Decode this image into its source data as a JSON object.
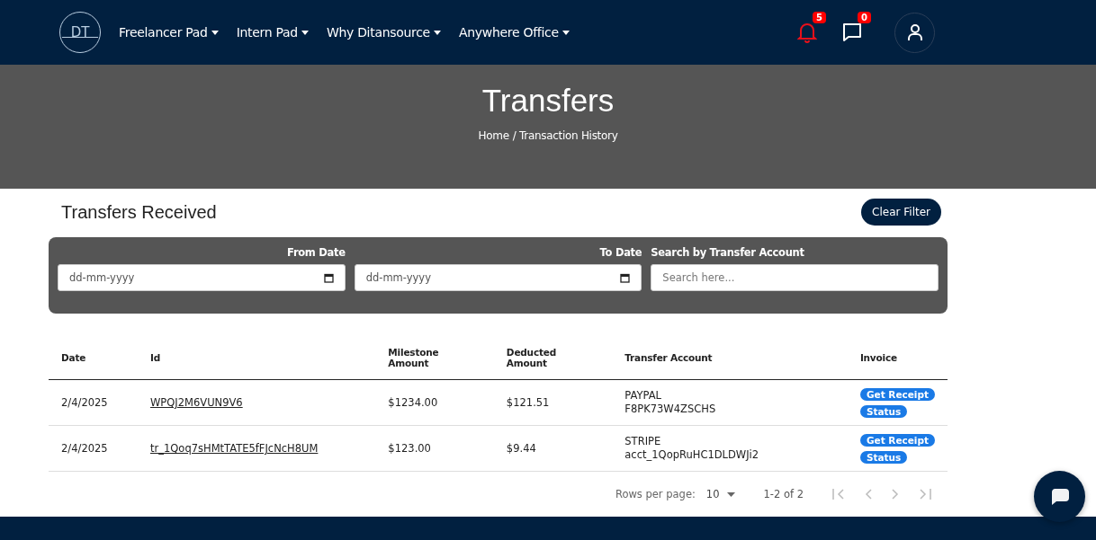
{
  "nav": {
    "logo": "DT",
    "menu": [
      {
        "label": "Freelancer Pad"
      },
      {
        "label": "Intern Pad"
      },
      {
        "label": "Why Ditansource"
      },
      {
        "label": "Anywhere Office"
      }
    ],
    "notifications": "5",
    "messages": "0"
  },
  "hero": {
    "title": "Transfers",
    "breadcrumb": [
      "Home",
      "/ Transaction History"
    ]
  },
  "section": {
    "title": "Transfers Received",
    "clear_button": "Clear Filter"
  },
  "filters": {
    "from": {
      "label": "From Date",
      "placeholder": "dd-mm-yyyy"
    },
    "to": {
      "label": "To Date",
      "placeholder": "dd-mm-yyyy"
    },
    "search": {
      "label": "Search by Transfer Account",
      "placeholder": "Search here..."
    }
  },
  "table": {
    "columns": [
      "Date",
      "Id",
      "Milestone Amount",
      "Deducted Amount",
      "Transfer Account",
      "Invoice"
    ],
    "rows": [
      {
        "date": "2/4/2025",
        "id": "WPQJ2M6VUN9V6",
        "milestone": "$1234.00",
        "deducted": "$121.51",
        "account_type": "PAYPAL",
        "account_id": "F8PK73W4ZSCHS",
        "actions": [
          "Get Receipt",
          "Status"
        ]
      },
      {
        "date": "2/4/2025",
        "id": "tr_1Qoq7sHMtTATE5fFJcNcH8UM",
        "milestone": "$123.00",
        "deducted": "$9.44",
        "account_type": "STRIPE",
        "account_id": "acct_1QopRuHC1DLDWJi2",
        "actions": [
          "Get Receipt",
          "Status"
        ]
      }
    ]
  },
  "pagination": {
    "rows_label": "Rows per page:",
    "rows_value": "10",
    "range": "1-2 of 2",
    "disabled": true
  }
}
